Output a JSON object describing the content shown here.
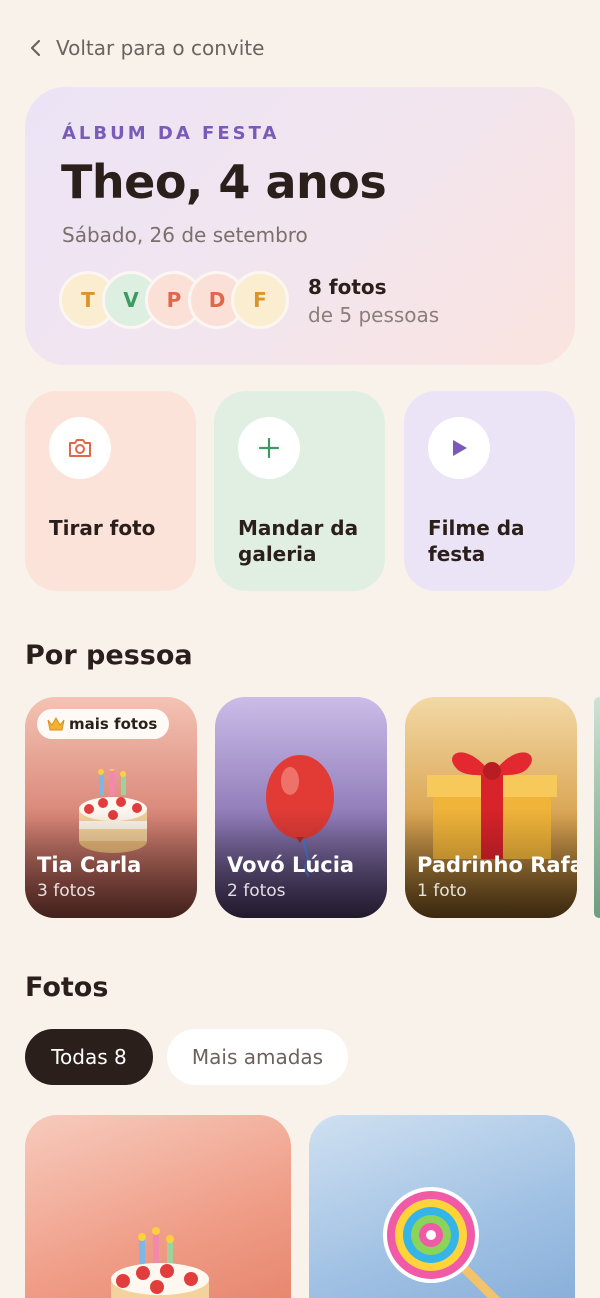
{
  "nav": {
    "back_label": "Voltar para o convite"
  },
  "hero": {
    "eyebrow": "ÁLBUM DA FESTA",
    "title": "Theo, 4 anos",
    "date": "Sábado, 26 de setembro",
    "avatars": [
      {
        "initial": "T",
        "bg": "#fbedcf",
        "fg": "#d9952b"
      },
      {
        "initial": "V",
        "bg": "#dcefe1",
        "fg": "#3f9a62"
      },
      {
        "initial": "P",
        "bg": "#fbe0d8",
        "fg": "#e0684a"
      },
      {
        "initial": "D",
        "bg": "#fbe0d8",
        "fg": "#e0684a"
      },
      {
        "initial": "F",
        "bg": "#fbedcf",
        "fg": "#d9952b"
      }
    ],
    "photo_count": "8 fotos",
    "people_count": "de 5 pessoas"
  },
  "actions": [
    {
      "label": "Tirar foto",
      "icon": "camera-icon",
      "bg": "#fbe3da",
      "icon_color": "#e0684a"
    },
    {
      "label": "Mandar da galeria",
      "icon": "plus-icon",
      "bg": "#e1efe3",
      "icon_color": "#3f9a62"
    },
    {
      "label": "Filme da festa",
      "icon": "play-icon",
      "bg": "#ebe3f6",
      "icon_color": "#7a5bb8"
    }
  ],
  "people_section": {
    "title": "Por pessoa",
    "badge": "mais fotos",
    "people": [
      {
        "name": "Tia Carla",
        "count": "3 fotos",
        "image": "cake-emoji"
      },
      {
        "name": "Vovó Lúcia",
        "count": "2 fotos",
        "image": "balloon-emoji"
      },
      {
        "name": "Padrinho Rafa",
        "count": "1 foto",
        "image": "gift-emoji"
      }
    ]
  },
  "photos_section": {
    "title": "Fotos",
    "filters": [
      {
        "label": "Todas 8",
        "active": true
      },
      {
        "label": "Mais amadas",
        "active": false
      }
    ],
    "photos": [
      {
        "image": "cake-emoji"
      },
      {
        "image": "lollipop-emoji"
      }
    ]
  }
}
